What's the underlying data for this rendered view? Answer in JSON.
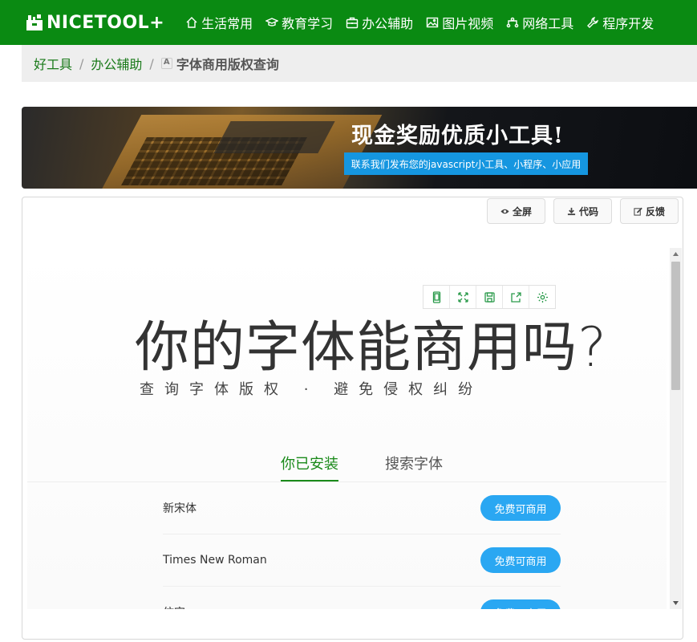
{
  "nav": {
    "logo": "NICETOOL+",
    "items": [
      {
        "label": "生活常用",
        "icon": "home-icon"
      },
      {
        "label": "教育学习",
        "icon": "graduation-cap-icon"
      },
      {
        "label": "办公辅助",
        "icon": "briefcase-icon"
      },
      {
        "label": "图片视频",
        "icon": "image-icon"
      },
      {
        "label": "网络工具",
        "icon": "network-icon"
      },
      {
        "label": "程序开发",
        "icon": "wrench-icon"
      }
    ]
  },
  "breadcrumb": {
    "home": "好工具",
    "category": "办公辅助",
    "current": "字体商用版权查询"
  },
  "banner": {
    "title": "现金奖励优质小工具!",
    "subtitle": "联系我们发布您的javascript小工具、小程序、小应用"
  },
  "panel": {
    "fullscreen": "全屏",
    "code": "代码",
    "feedback": "反馈"
  },
  "tool": {
    "title": "你的字体能商用吗?",
    "subtitle": "查询字体版权 · 避免侵权纠纷",
    "tabs": {
      "installed": "你已安装",
      "search": "搜索字体"
    },
    "fonts": [
      {
        "name": "新宋体",
        "status": "免费可商用"
      },
      {
        "name": "Times New Roman",
        "status": "免费可商用"
      },
      {
        "name": "仿宋",
        "status": "免费可商用"
      }
    ]
  },
  "colors": {
    "nav_bg": "#0a8a12",
    "accent_green": "#1a8a1a",
    "badge_blue": "#2aa7f2",
    "banner_blue": "#1596e0"
  }
}
